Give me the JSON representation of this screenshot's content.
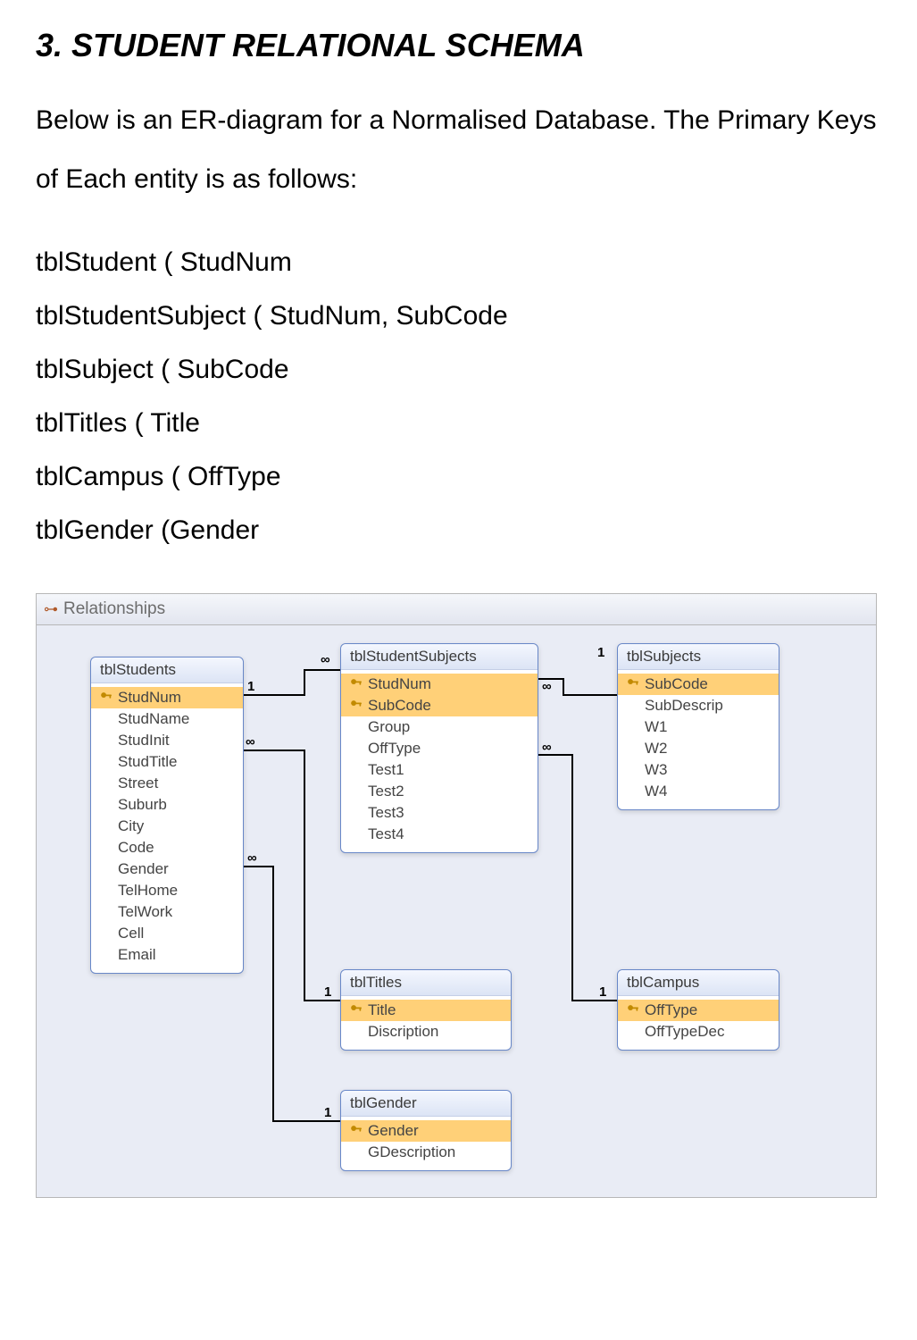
{
  "heading": "3. STUDENT RELATIONAL SCHEMA",
  "intro": "Below is an ER-diagram for a Normalised Database. The Primary Keys of Each entity is as follows:",
  "pk": {
    "l1": "tblStudent ( StudNum",
    "l2": "tblStudentSubject ( StudNum, SubCode",
    "l3": "tblSubject ( SubCode",
    "l4": "tblTitles ( Title",
    "l5": "tblCampus ( OffType",
    "l6": "tblGender (Gender"
  },
  "window": {
    "title": "Relationships"
  },
  "entities": {
    "students": {
      "name": "tblStudents",
      "fields": [
        "StudNum",
        "StudName",
        "StudInit",
        "StudTitle",
        "Street",
        "Suburb",
        "City",
        "Code",
        "Gender",
        "TelHome",
        "TelWork",
        "Cell",
        "Email"
      ],
      "pk_indexes": [
        0
      ]
    },
    "studentSubjects": {
      "name": "tblStudentSubjects",
      "fields": [
        "StudNum",
        "SubCode",
        "Group",
        "OffType",
        "Test1",
        "Test2",
        "Test3",
        "Test4"
      ],
      "pk_indexes": [
        0,
        1
      ]
    },
    "subjects": {
      "name": "tblSubjects",
      "fields": [
        "SubCode",
        "SubDescrip",
        "W1",
        "W2",
        "W3",
        "W4"
      ],
      "pk_indexes": [
        0
      ]
    },
    "titles": {
      "name": "tblTitles",
      "fields": [
        "Title",
        "Discription"
      ],
      "pk_indexes": [
        0
      ]
    },
    "campus": {
      "name": "tblCampus",
      "fields": [
        "OffType",
        "OffTypeDec"
      ],
      "pk_indexes": [
        0
      ]
    },
    "gender": {
      "name": "tblGender",
      "fields": [
        "Gender",
        "GDescription"
      ],
      "pk_indexes": [
        0
      ]
    }
  },
  "relationships": [
    {
      "from": "tblStudents.StudNum",
      "to": "tblStudentSubjects.StudNum",
      "card": "1:∞"
    },
    {
      "from": "tblSubjects.SubCode",
      "to": "tblStudentSubjects.SubCode",
      "card": "1:∞"
    },
    {
      "from": "tblTitles.Title",
      "to": "tblStudents.StudTitle",
      "card": "1:∞"
    },
    {
      "from": "tblGender.Gender",
      "to": "tblStudents.Gender",
      "card": "1:∞"
    },
    {
      "from": "tblCampus.OffType",
      "to": "tblStudentSubjects.OffType",
      "card": "1:∞"
    }
  ],
  "card": {
    "one": "1",
    "many": "∞"
  }
}
